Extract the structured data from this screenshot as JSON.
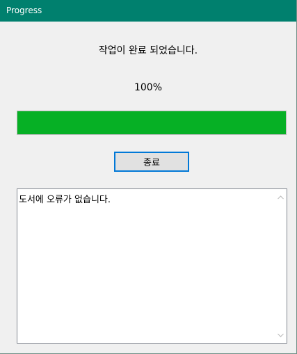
{
  "window": {
    "title": "Progress"
  },
  "status": {
    "message": "작업이 완료 되었습니다.",
    "percent_label": "100%",
    "progress_value": 1.0
  },
  "buttons": {
    "close_label": "종료"
  },
  "log": {
    "text": "도서에 오류가 없습니다."
  },
  "icons": {
    "scroll_up": "chevron-up-icon",
    "scroll_down": "chevron-down-icon"
  },
  "colors": {
    "titlebar": "#00806e",
    "progress_fill": "#06b025",
    "button_focus_border": "#0078d7"
  }
}
